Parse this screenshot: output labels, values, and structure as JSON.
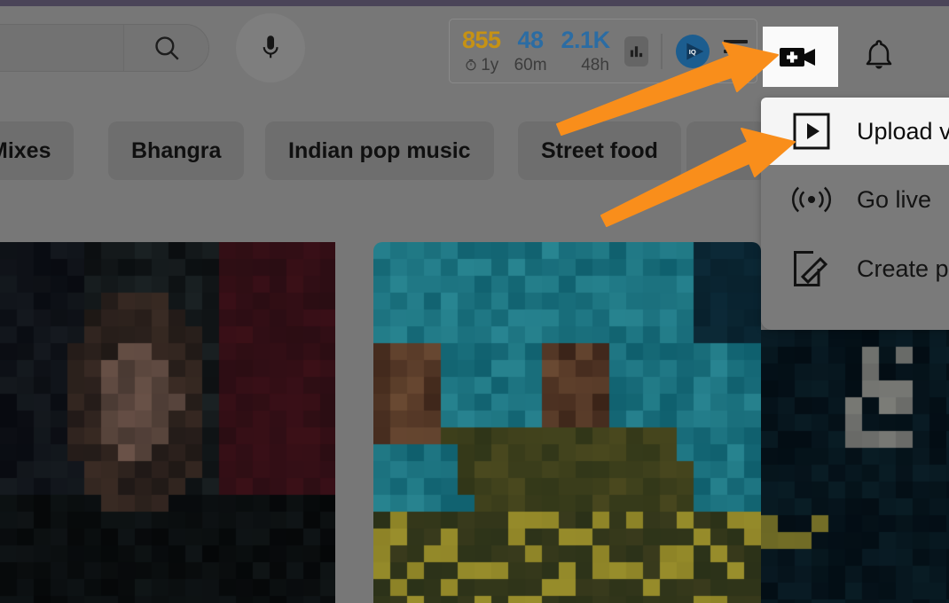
{
  "header": {
    "search": {
      "value": "",
      "placeholder": "",
      "icon": "search-icon"
    },
    "mic": {
      "icon": "microphone-icon"
    },
    "stats": {
      "items": [
        {
          "value": "855",
          "sublabel": "1y",
          "color": "#c69214",
          "has_timer_icon": true
        },
        {
          "value": "48",
          "sublabel": "60m",
          "color": "#2b6ca3",
          "has_timer_icon": false
        },
        {
          "value": "2.1K",
          "sublabel": "48h",
          "color": "#2b6ca3",
          "has_timer_icon": false
        }
      ],
      "bar_chart_icon": "bar-chart-icon",
      "iq_badge_label": "IQ",
      "iq_badge_color": "#1c5d8f",
      "menu_icon": "hamburger-menu-icon"
    },
    "create_button": {
      "icon": "video-camera-plus-icon",
      "highlight_color": "#fafafa"
    },
    "notifications": {
      "icon": "bell-icon"
    }
  },
  "chips": [
    {
      "label": "Mixes"
    },
    {
      "label": "Bhangra"
    },
    {
      "label": "Indian pop music"
    },
    {
      "label": "Street food"
    },
    {
      "label": ""
    }
  ],
  "create_menu": {
    "items": [
      {
        "label": "Upload v",
        "icon": "play-square-icon",
        "active": true
      },
      {
        "label": "Go live",
        "icon": "broadcast-icon",
        "active": false
      },
      {
        "label": "Create p",
        "icon": "pencil-square-icon",
        "active": false
      }
    ]
  },
  "thumbnails": [
    {
      "name": "video-thumbnail-1",
      "dominant_color": "#1a0d12"
    },
    {
      "name": "video-thumbnail-2",
      "dominant_color": "#14707d"
    },
    {
      "name": "video-thumbnail-3",
      "dominant_color": "#061620"
    }
  ],
  "annotations": {
    "arrow_color": "#f98e1b",
    "arrows": [
      {
        "name": "arrow-to-create-button",
        "target": "create_button"
      },
      {
        "name": "arrow-to-upload-video",
        "target": "upload_video_menu_item"
      }
    ]
  },
  "colors": {
    "overlay_gray": "#777777",
    "top_strip": "#4a4458",
    "accent_orange": "#f98e1b",
    "stat_gold": "#c69214",
    "stat_blue": "#2b6ca3"
  }
}
